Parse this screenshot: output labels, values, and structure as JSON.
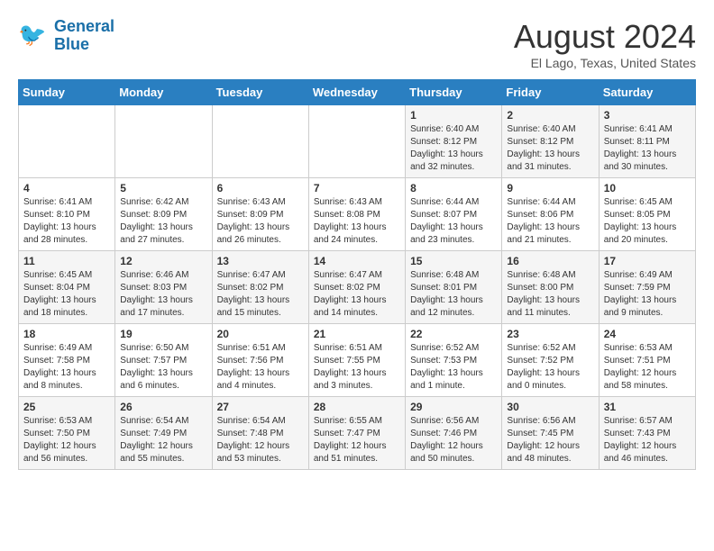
{
  "logo": {
    "line1": "General",
    "line2": "Blue"
  },
  "title": "August 2024",
  "location": "El Lago, Texas, United States",
  "days_of_week": [
    "Sunday",
    "Monday",
    "Tuesday",
    "Wednesday",
    "Thursday",
    "Friday",
    "Saturday"
  ],
  "weeks": [
    [
      {
        "day": "",
        "content": ""
      },
      {
        "day": "",
        "content": ""
      },
      {
        "day": "",
        "content": ""
      },
      {
        "day": "",
        "content": ""
      },
      {
        "day": "1",
        "content": "Sunrise: 6:40 AM\nSunset: 8:12 PM\nDaylight: 13 hours\nand 32 minutes."
      },
      {
        "day": "2",
        "content": "Sunrise: 6:40 AM\nSunset: 8:12 PM\nDaylight: 13 hours\nand 31 minutes."
      },
      {
        "day": "3",
        "content": "Sunrise: 6:41 AM\nSunset: 8:11 PM\nDaylight: 13 hours\nand 30 minutes."
      }
    ],
    [
      {
        "day": "4",
        "content": "Sunrise: 6:41 AM\nSunset: 8:10 PM\nDaylight: 13 hours\nand 28 minutes."
      },
      {
        "day": "5",
        "content": "Sunrise: 6:42 AM\nSunset: 8:09 PM\nDaylight: 13 hours\nand 27 minutes."
      },
      {
        "day": "6",
        "content": "Sunrise: 6:43 AM\nSunset: 8:09 PM\nDaylight: 13 hours\nand 26 minutes."
      },
      {
        "day": "7",
        "content": "Sunrise: 6:43 AM\nSunset: 8:08 PM\nDaylight: 13 hours\nand 24 minutes."
      },
      {
        "day": "8",
        "content": "Sunrise: 6:44 AM\nSunset: 8:07 PM\nDaylight: 13 hours\nand 23 minutes."
      },
      {
        "day": "9",
        "content": "Sunrise: 6:44 AM\nSunset: 8:06 PM\nDaylight: 13 hours\nand 21 minutes."
      },
      {
        "day": "10",
        "content": "Sunrise: 6:45 AM\nSunset: 8:05 PM\nDaylight: 13 hours\nand 20 minutes."
      }
    ],
    [
      {
        "day": "11",
        "content": "Sunrise: 6:45 AM\nSunset: 8:04 PM\nDaylight: 13 hours\nand 18 minutes."
      },
      {
        "day": "12",
        "content": "Sunrise: 6:46 AM\nSunset: 8:03 PM\nDaylight: 13 hours\nand 17 minutes."
      },
      {
        "day": "13",
        "content": "Sunrise: 6:47 AM\nSunset: 8:02 PM\nDaylight: 13 hours\nand 15 minutes."
      },
      {
        "day": "14",
        "content": "Sunrise: 6:47 AM\nSunset: 8:02 PM\nDaylight: 13 hours\nand 14 minutes."
      },
      {
        "day": "15",
        "content": "Sunrise: 6:48 AM\nSunset: 8:01 PM\nDaylight: 13 hours\nand 12 minutes."
      },
      {
        "day": "16",
        "content": "Sunrise: 6:48 AM\nSunset: 8:00 PM\nDaylight: 13 hours\nand 11 minutes."
      },
      {
        "day": "17",
        "content": "Sunrise: 6:49 AM\nSunset: 7:59 PM\nDaylight: 13 hours\nand 9 minutes."
      }
    ],
    [
      {
        "day": "18",
        "content": "Sunrise: 6:49 AM\nSunset: 7:58 PM\nDaylight: 13 hours\nand 8 minutes."
      },
      {
        "day": "19",
        "content": "Sunrise: 6:50 AM\nSunset: 7:57 PM\nDaylight: 13 hours\nand 6 minutes."
      },
      {
        "day": "20",
        "content": "Sunrise: 6:51 AM\nSunset: 7:56 PM\nDaylight: 13 hours\nand 4 minutes."
      },
      {
        "day": "21",
        "content": "Sunrise: 6:51 AM\nSunset: 7:55 PM\nDaylight: 13 hours\nand 3 minutes."
      },
      {
        "day": "22",
        "content": "Sunrise: 6:52 AM\nSunset: 7:53 PM\nDaylight: 13 hours\nand 1 minute."
      },
      {
        "day": "23",
        "content": "Sunrise: 6:52 AM\nSunset: 7:52 PM\nDaylight: 13 hours\nand 0 minutes."
      },
      {
        "day": "24",
        "content": "Sunrise: 6:53 AM\nSunset: 7:51 PM\nDaylight: 12 hours\nand 58 minutes."
      }
    ],
    [
      {
        "day": "25",
        "content": "Sunrise: 6:53 AM\nSunset: 7:50 PM\nDaylight: 12 hours\nand 56 minutes."
      },
      {
        "day": "26",
        "content": "Sunrise: 6:54 AM\nSunset: 7:49 PM\nDaylight: 12 hours\nand 55 minutes."
      },
      {
        "day": "27",
        "content": "Sunrise: 6:54 AM\nSunset: 7:48 PM\nDaylight: 12 hours\nand 53 minutes."
      },
      {
        "day": "28",
        "content": "Sunrise: 6:55 AM\nSunset: 7:47 PM\nDaylight: 12 hours\nand 51 minutes."
      },
      {
        "day": "29",
        "content": "Sunrise: 6:56 AM\nSunset: 7:46 PM\nDaylight: 12 hours\nand 50 minutes."
      },
      {
        "day": "30",
        "content": "Sunrise: 6:56 AM\nSunset: 7:45 PM\nDaylight: 12 hours\nand 48 minutes."
      },
      {
        "day": "31",
        "content": "Sunrise: 6:57 AM\nSunset: 7:43 PM\nDaylight: 12 hours\nand 46 minutes."
      }
    ]
  ]
}
